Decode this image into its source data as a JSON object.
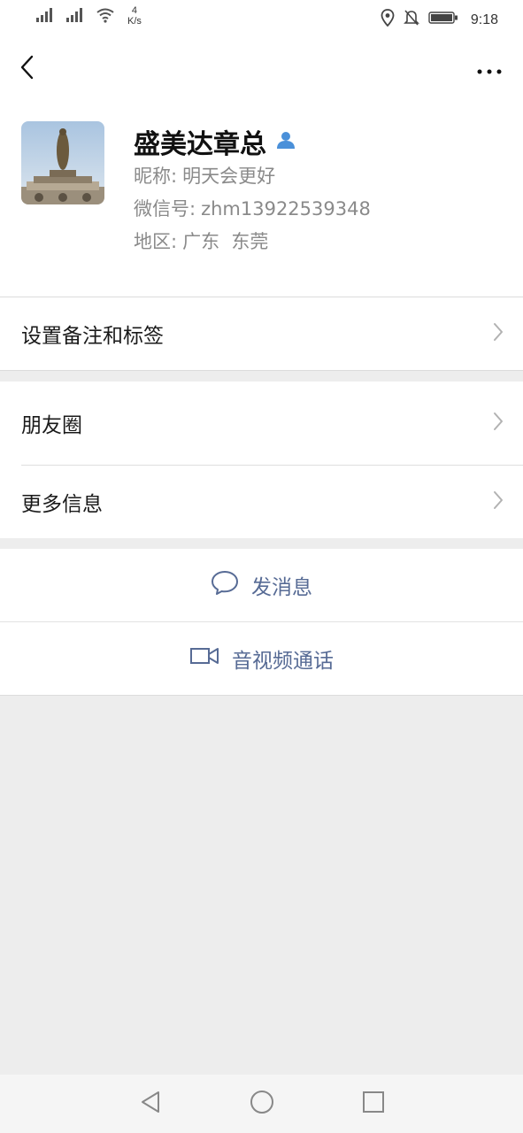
{
  "status_bar": {
    "net_speed_value": "4",
    "net_speed_unit": "K/s",
    "time": "9:18",
    "icons": [
      "signal-icon",
      "signal-icon",
      "wifi-icon",
      "location-icon",
      "mute-bell-icon",
      "battery-icon"
    ]
  },
  "nav": {
    "back_icon": "chevron-left-icon",
    "more_icon": "more-dots-icon"
  },
  "profile": {
    "avatar_icon": "statue-photo",
    "name": "盛美达章总",
    "name_badge_icon": "user-badge-icon",
    "nickname_label": "昵称:",
    "nickname": "明天会更好",
    "wechat_id_label": "微信号:",
    "wechat_id": "zhm13922539348",
    "region_label": "地区:",
    "region": "广东  东莞"
  },
  "menu": {
    "remark_label": "设置备注和标签",
    "moments_label": "朋友圈",
    "more_info_label": "更多信息"
  },
  "actions": {
    "message_label": "发消息",
    "message_icon": "chat-bubble-icon",
    "call_label": "音视频通话",
    "call_icon": "video-camera-icon"
  },
  "colors": {
    "link": "#576b95",
    "badge": "#4a90d9",
    "background": "#ededed"
  },
  "system_nav": [
    "back-triangle-icon",
    "home-circle-icon",
    "recents-square-icon"
  ]
}
